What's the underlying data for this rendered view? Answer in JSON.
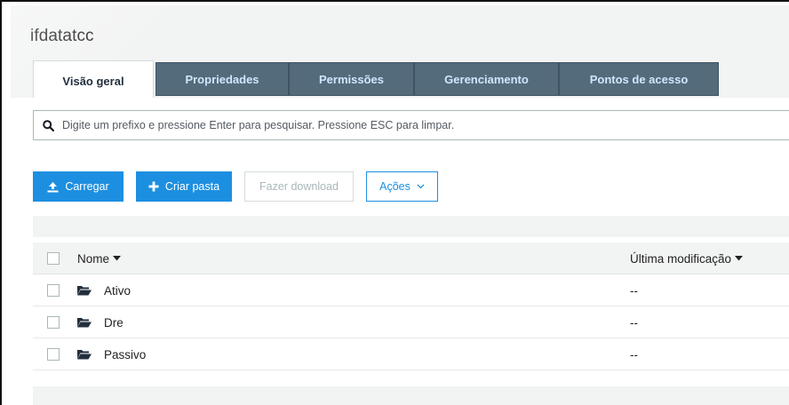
{
  "bucket": {
    "name": "ifdatatcc"
  },
  "tabs": [
    {
      "label": "Visão geral",
      "active": true
    },
    {
      "label": "Propriedades",
      "active": false
    },
    {
      "label": "Permissões",
      "active": false
    },
    {
      "label": "Gerenciamento",
      "active": false
    },
    {
      "label": "Pontos de acesso",
      "active": false
    }
  ],
  "search": {
    "placeholder": "Digite um prefixo e pressione Enter para pesquisar. Pressione ESC para limpar.",
    "icon": "search-icon"
  },
  "toolbar": {
    "upload_label": "Carregar",
    "create_folder_label": "Criar pasta",
    "download_label": "Fazer download",
    "actions_label": "Ações"
  },
  "table": {
    "columns": {
      "name": "Nome",
      "modified": "Última modificação"
    },
    "rows": [
      {
        "name": "Ativo",
        "modified": "--",
        "icon": "folder-icon"
      },
      {
        "name": "Dre",
        "modified": "--",
        "icon": "folder-icon"
      },
      {
        "name": "Passivo",
        "modified": "--",
        "icon": "folder-icon"
      }
    ]
  },
  "colors": {
    "tab_inactive_bg": "#546b7b",
    "tab_inactive_text": "#cfe7ff",
    "primary_button": "#1d8fe0",
    "header_bg": "#f2f3f3"
  }
}
